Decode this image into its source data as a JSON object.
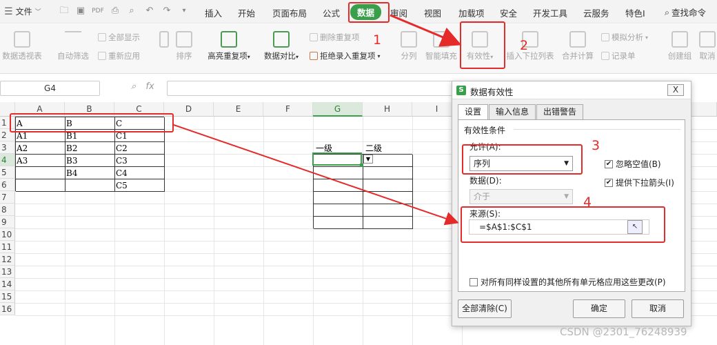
{
  "menubar": {
    "file_label": "文件",
    "tabs": [
      "插入",
      "开始",
      "页面布局",
      "公式",
      "数据",
      "审阅",
      "视图",
      "加载项",
      "安全",
      "开发工具",
      "云服务",
      "特色I"
    ],
    "active_tab": "数据",
    "search_label": "查找命令"
  },
  "ribbon": {
    "pivot": "数据透视表",
    "autofilter": "自动筛选",
    "show_all": "全部显示",
    "reapply": "重新应用",
    "sort": "排序",
    "highlight_dup": "高亮重复项",
    "data_compare": "数据对比",
    "delete_dup": "删除重复项",
    "reject_dup": "拒绝录入重复项",
    "split": "分列",
    "smart_fill": "智能填充",
    "validity": "有效性",
    "insert_dropdown": "插入下拉列表",
    "merge_calc": "合并计算",
    "simulation": "模拟分析",
    "record_form": "记录单",
    "create_group": "创建组",
    "cancel_group": "取消"
  },
  "formula_bar": {
    "name_box": "G4",
    "fx_label": "fx"
  },
  "sheet": {
    "columns": [
      "A",
      "B",
      "C",
      "D",
      "E",
      "F",
      "G",
      "H",
      "I"
    ],
    "rows": [
      "1",
      "2",
      "3",
      "4",
      "5",
      "6",
      "7",
      "8",
      "9",
      "10",
      "11",
      "12",
      "13",
      "14",
      "15",
      "16"
    ],
    "table1": [
      [
        "A",
        "B",
        "C"
      ],
      [
        "A1",
        "B1",
        "C1"
      ],
      [
        "A2",
        "B2",
        "C2"
      ],
      [
        "A3",
        "B3",
        "C3"
      ],
      [
        "",
        "B4",
        "C4"
      ],
      [
        "",
        "",
        "C5"
      ]
    ],
    "table2_headers": [
      "一级",
      "二级"
    ]
  },
  "dialog": {
    "title": "数据有效性",
    "close": "X",
    "tabs": [
      "设置",
      "输入信息",
      "出错警告"
    ],
    "section": "有效性条件",
    "allow_label": "允许(A):",
    "allow_value": "序列",
    "ignore_blank": "忽略空值(B)",
    "dropdown_arrow": "提供下拉箭头(I)",
    "data_label": "数据(D):",
    "data_value": "介于",
    "source_label": "来源(S):",
    "source_value": "=$A$1:$C$1",
    "apply_all": "对所有同样设置的其他所有单元格应用这些更改(P)",
    "clear_all": "全部清除(C)",
    "ok": "确定",
    "cancel": "取消"
  },
  "annotations": {
    "step1": "1",
    "step2": "2",
    "step3": "3",
    "step4": "4",
    "color": "#e52a2a"
  },
  "watermark": "CSDN @2301_76248939",
  "colors": {
    "accent": "#3a9f4a",
    "annotation": "#e52a2a"
  }
}
